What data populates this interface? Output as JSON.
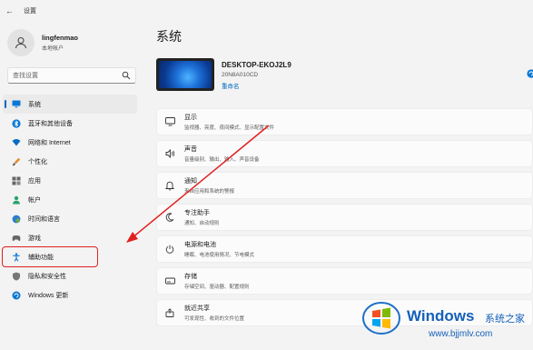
{
  "window": {
    "title": "设置"
  },
  "profile": {
    "name": "lingfenmao",
    "account_type": "本地帐户"
  },
  "search": {
    "placeholder": "查找设置"
  },
  "sidebar": {
    "items": [
      {
        "label": "系统",
        "icon": "monitor-icon"
      },
      {
        "label": "蓝牙和其他设备",
        "icon": "bluetooth-icon"
      },
      {
        "label": "网络和 Internet",
        "icon": "wifi-icon"
      },
      {
        "label": "个性化",
        "icon": "brush-icon"
      },
      {
        "label": "应用",
        "icon": "apps-icon"
      },
      {
        "label": "帐户",
        "icon": "person-icon"
      },
      {
        "label": "时间和语言",
        "icon": "globe-clock-icon"
      },
      {
        "label": "游戏",
        "icon": "gamepad-icon"
      },
      {
        "label": "辅助功能",
        "icon": "accessibility-icon"
      },
      {
        "label": "隐私和安全性",
        "icon": "shield-icon"
      },
      {
        "label": "Windows 更新",
        "icon": "update-icon"
      }
    ],
    "active_index": 0,
    "highlighted_index": 8
  },
  "main": {
    "title": "系统",
    "device": {
      "name": "DESKTOP-EKOJ2L9",
      "model": "20N8A010CD",
      "rename": "重命名"
    },
    "cards": [
      {
        "title": "显示",
        "subtitle": "监视器、亮度、夜间模式、显示配置文件",
        "icon": "display-icon"
      },
      {
        "title": "声音",
        "subtitle": "音量级别、输出、输入、声音设备",
        "icon": "speaker-icon"
      },
      {
        "title": "通知",
        "subtitle": "来自应用和系统的警报",
        "icon": "bell-icon"
      },
      {
        "title": "专注助手",
        "subtitle": "通知、自动规则",
        "icon": "moon-icon"
      },
      {
        "title": "电源和电池",
        "subtitle": "睡眠、电池使用情况、节电模式",
        "icon": "power-icon"
      },
      {
        "title": "存储",
        "subtitle": "存储空间、驱动器、配置规则",
        "icon": "storage-icon"
      },
      {
        "title": "就近共享",
        "subtitle": "可发现性、收到的文件位置",
        "icon": "share-icon"
      }
    ]
  },
  "watermark": {
    "title": "Windows",
    "title_cn": "系统之家",
    "url": "www.bjjmlv.com"
  },
  "colors": {
    "accent": "#0067c0",
    "highlight_box": "#e02020",
    "arrow": "#e02020"
  }
}
